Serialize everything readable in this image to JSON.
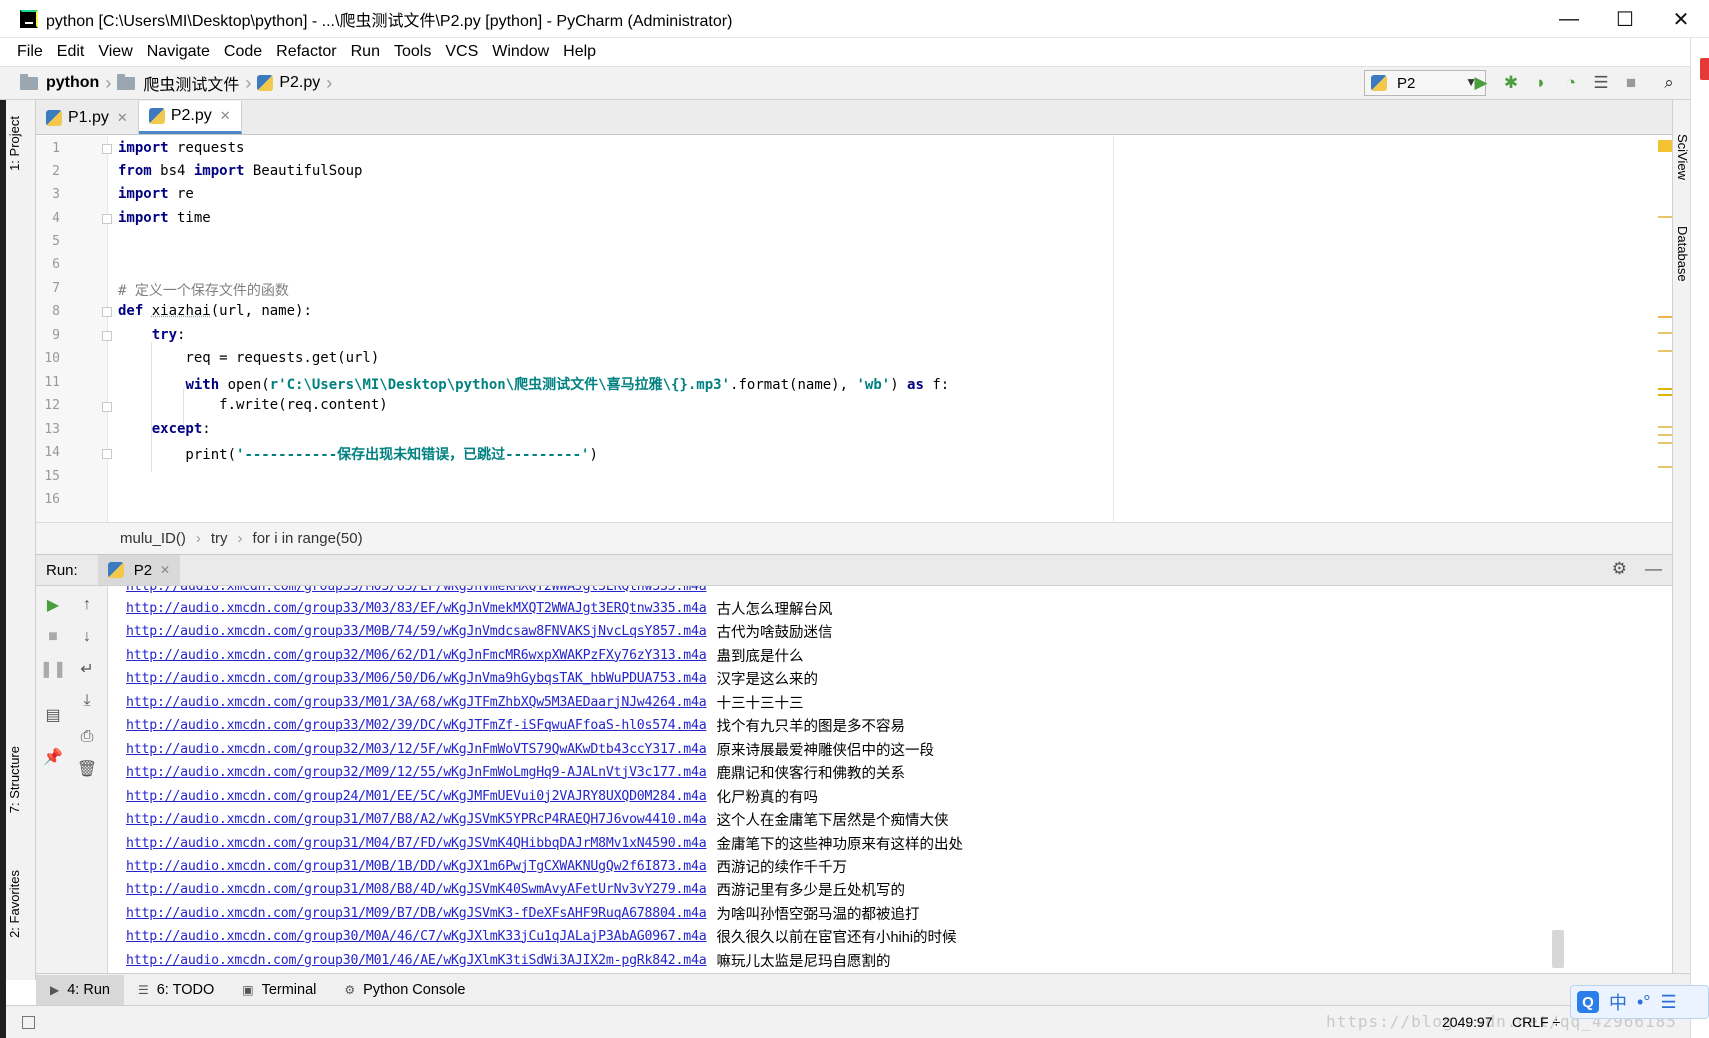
{
  "window": {
    "title": "python [C:\\Users\\MI\\Desktop\\python] - ...\\爬虫测试文件\\P2.py [python] - PyCharm (Administrator)",
    "minimize": "—",
    "maximize": "☐",
    "close": "✕"
  },
  "menu": [
    "File",
    "Edit",
    "View",
    "Navigate",
    "Code",
    "Refactor",
    "Run",
    "Tools",
    "VCS",
    "Window",
    "Help"
  ],
  "nav": {
    "crumbs": [
      "python",
      "爬虫测试文件",
      "P2.py"
    ]
  },
  "run_config": {
    "label": "P2"
  },
  "editor_tabs": [
    {
      "label": "P1.py",
      "active": false
    },
    {
      "label": "P2.py",
      "active": true
    }
  ],
  "code": {
    "line_numbers": [
      "1",
      "2",
      "3",
      "4",
      "5",
      "6",
      "7",
      "8",
      "9",
      "10",
      "11",
      "12",
      "13",
      "14",
      "15",
      "16"
    ],
    "lines": [
      {
        "n": 1,
        "t": "import requests"
      },
      {
        "n": 2,
        "t": "from bs4 import BeautifulSoup"
      },
      {
        "n": 3,
        "t": "import re"
      },
      {
        "n": 4,
        "t": "import time"
      },
      {
        "n": 5,
        "t": ""
      },
      {
        "n": 6,
        "t": ""
      },
      {
        "n": 7,
        "t": "# 定义一个保存文件的函数"
      },
      {
        "n": 8,
        "t": "def xiazhai(url, name):"
      },
      {
        "n": 9,
        "t": "    try:"
      },
      {
        "n": 10,
        "t": "        req = requests.get(url)"
      },
      {
        "n": 11,
        "t": "        with open(r'C:\\Users\\MI\\Desktop\\python\\爬虫测试文件\\喜马拉雅\\{}.mp3'.format(name), 'wb') as f:"
      },
      {
        "n": 12,
        "t": "            f.write(req.content)"
      },
      {
        "n": 13,
        "t": "    except:"
      },
      {
        "n": 14,
        "t": "        print('-----------保存出现未知错误，已跳过---------')"
      },
      {
        "n": 15,
        "t": ""
      },
      {
        "n": 16,
        "t": ""
      }
    ]
  },
  "editor_breadcrumbs": [
    "mulu_ID()",
    "try",
    "for i in range(50)"
  ],
  "run_panel": {
    "label": "Run:",
    "tab": "P2"
  },
  "console": [
    {
      "url": "http://audio.xmcdn.com/group33/M03/83/EF/wKgJnVmekMXQT2WWAJgt3ERQtnw335.m4a",
      "title": "古人怎么理解台风"
    },
    {
      "url": "http://audio.xmcdn.com/group33/M0B/74/59/wKgJnVmdcsaw8FNVAKSjNvcLqsY857.m4a",
      "title": "古代为啥鼓励迷信"
    },
    {
      "url": "http://audio.xmcdn.com/group32/M06/62/D1/wKgJnFmcMR6wxpXWAKPzFXy76zY313.m4a",
      "title": "蛊到底是什么"
    },
    {
      "url": "http://audio.xmcdn.com/group33/M06/50/D6/wKgJnVma9hGybqsTAK_hbWuPDUA753.m4a",
      "title": "汉字是这么来的"
    },
    {
      "url": "http://audio.xmcdn.com/group33/M01/3A/68/wKgJTFmZhbXQw5M3AEDaarjNJw4264.m4a",
      "title": "十三十三十三"
    },
    {
      "url": "http://audio.xmcdn.com/group33/M02/39/DC/wKgJTFmZf-iSFqwuAFfoaS-hl0s574.m4a",
      "title": "找个有九只羊的图是多不容易"
    },
    {
      "url": "http://audio.xmcdn.com/group32/M03/12/5F/wKgJnFmWoVTS79QwAKwDtb43ccY317.m4a",
      "title": "原来诗展最爱神雕侠侣中的这一段"
    },
    {
      "url": "http://audio.xmcdn.com/group32/M09/12/55/wKgJnFmWoLmgHq9-AJALnVtjV3c177.m4a",
      "title": "鹿鼎记和侠客行和佛教的关系"
    },
    {
      "url": "http://audio.xmcdn.com/group24/M01/EE/5C/wKgJMFmUEVui0j2VAJRY8UXQD0M284.m4a",
      "title": "化尸粉真的有吗"
    },
    {
      "url": "http://audio.xmcdn.com/group31/M07/B8/A2/wKgJSVmK5YPRcP4RAEQH7J6vow4410.m4a",
      "title": "这个人在金庸笔下居然是个痴情大侠"
    },
    {
      "url": "http://audio.xmcdn.com/group31/M04/B7/FD/wKgJSVmK4QHibbqDAJrM8Mv1xN4590.m4a",
      "title": "金庸笔下的这些神功原来有这样的出处"
    },
    {
      "url": "http://audio.xmcdn.com/group31/M0B/1B/DD/wKgJX1m6PwjTgCXWAKNUgQw2f6I873.m4a",
      "title": "西游记的续作千千万"
    },
    {
      "url": "http://audio.xmcdn.com/group31/M08/B8/4D/wKgJSVmK40SwmAvyAFetUrNv3vY279.m4a",
      "title": "西游记里有多少是丘处机写的"
    },
    {
      "url": "http://audio.xmcdn.com/group31/M09/B7/DB/wKgJSVmK3-fDeXFsAHF9RuqA678804.m4a",
      "title": "为啥叫孙悟空弼马温的都被追打"
    },
    {
      "url": "http://audio.xmcdn.com/group30/M0A/46/C7/wKgJXlmK33jCu1qJALajP3AbAG0967.m4a",
      "title": "很久很久以前在宦官还有小hihi的时候"
    },
    {
      "url": "http://audio.xmcdn.com/group30/M01/46/AE/wKgJXlmK3tiSdWi3AJIX2m-pgRk842.m4a",
      "title": "嘛玩儿太监是尼玛自愿割的"
    }
  ],
  "left_tool_tabs": [
    "1: Project",
    "7: Structure",
    "2: Favorites"
  ],
  "right_tool_tabs": [
    "SciView",
    "Database"
  ],
  "bottom_tabs": [
    {
      "label": "4: Run",
      "active": true
    },
    {
      "label": "6: TODO",
      "active": false
    },
    {
      "label": "Terminal",
      "active": false
    },
    {
      "label": "Python Console",
      "active": false
    }
  ],
  "status": {
    "position": "2049:97",
    "line_sep": "CRLF ÷",
    "watermark": "https://blog.csdn.net/qq_42966185"
  },
  "ime": {
    "q": "Q",
    "lang": "中",
    "moon": "•°",
    "extra": "☰"
  }
}
